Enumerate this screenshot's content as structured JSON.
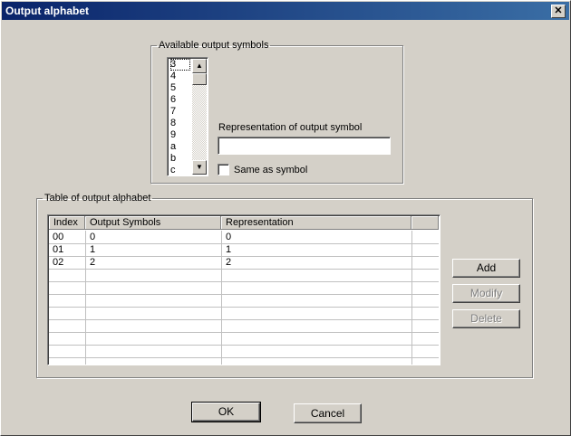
{
  "window": {
    "title": "Output alphabet",
    "close_glyph": "✕"
  },
  "available": {
    "legend": "Available output symbols",
    "items": [
      "3",
      "4",
      "5",
      "6",
      "7",
      "8",
      "9",
      "a",
      "b",
      "c"
    ],
    "selected": "3",
    "representation_label": "Representation of output symbol",
    "representation_value": "",
    "same_as_symbol_label": "Same as symbol",
    "same_as_symbol_checked": false
  },
  "table_group": {
    "legend": "Table of output alphabet",
    "columns": [
      "Index",
      "Output Symbols",
      "Representation"
    ],
    "rows": [
      {
        "index": "00",
        "symbol": "0",
        "representation": "0"
      },
      {
        "index": "01",
        "symbol": "1",
        "representation": "1"
      },
      {
        "index": "02",
        "symbol": "2",
        "representation": "2"
      }
    ]
  },
  "buttons": {
    "add": "Add",
    "modify": "Modify",
    "delete": "Delete",
    "ok": "OK",
    "cancel": "Cancel"
  },
  "icons": {
    "scroll_up": "scroll-up-arrow-icon",
    "scroll_down": "scroll-down-arrow-icon"
  }
}
